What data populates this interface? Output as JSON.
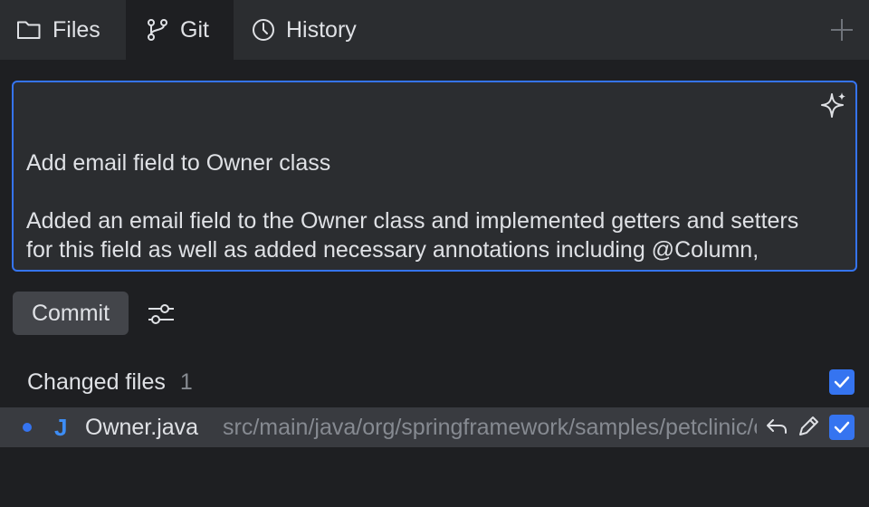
{
  "tabs": [
    {
      "label": "Files",
      "icon": "folder-icon"
    },
    {
      "label": "Git",
      "icon": "git-branch-icon",
      "active": true
    },
    {
      "label": "History",
      "icon": "clock-icon"
    }
  ],
  "commit_message": {
    "value": "Add email field to Owner class\n\nAdded an email field to the Owner class and implemented getters and setters for this field as well as added necessary annotations including @Column, @NotEmpty and @Email to ensure valid email addresses are provided."
  },
  "commit_button": {
    "label": "Commit"
  },
  "changes": {
    "header": "Changed files",
    "count": "1",
    "files": [
      {
        "type_icon": "J",
        "name": "Owner.java",
        "path": "src/main/java/org/springframework/samples/petclinic/owner"
      }
    ]
  },
  "colors": {
    "accent": "#3574f0",
    "panel": "#2b2d30",
    "background": "#1e1f22"
  }
}
